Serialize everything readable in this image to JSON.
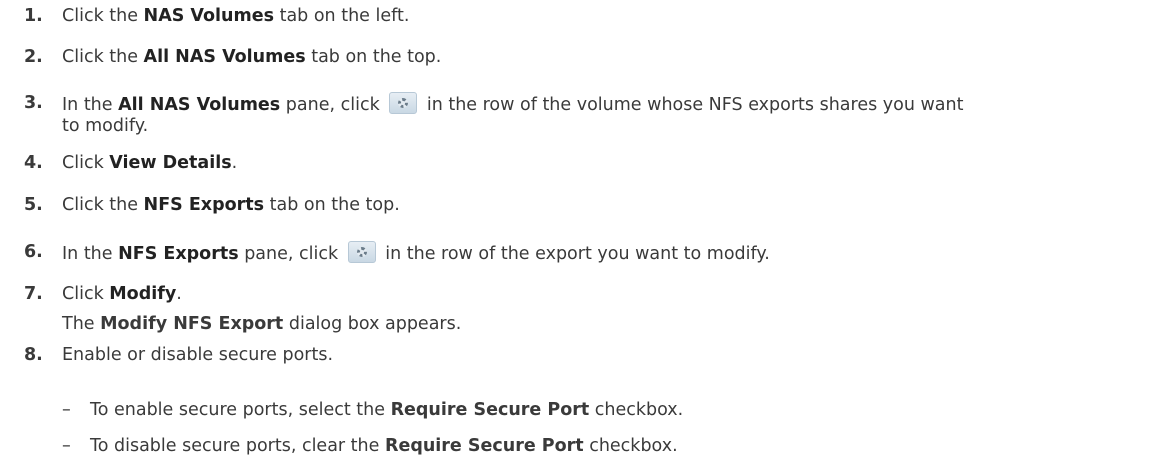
{
  "steps": [
    {
      "num": "1.",
      "pre": "Click the ",
      "b1": "NAS Volumes",
      "post": " tab on the left."
    },
    {
      "num": "2.",
      "pre": "Click the ",
      "b1": "All NAS Volumes",
      "post": " tab on the top."
    },
    {
      "num": "3.",
      "pre": "In the ",
      "b1": "All NAS Volumes",
      "mid": " pane, click ",
      "post": " in the row of the volume whose NFS exports shares you want",
      "line2": "to modify."
    },
    {
      "num": "4.",
      "pre": "Click ",
      "b1": "View Details",
      "post": "."
    },
    {
      "num": "5.",
      "pre": "Click the ",
      "b1": "NFS Exports",
      "post": " tab on the top."
    },
    {
      "num": "6.",
      "pre": "In the ",
      "b1": "NFS Exports",
      "mid": " pane, click ",
      "post": " in the row of the export you want to modify."
    },
    {
      "num": "7.",
      "pre": "Click ",
      "b1": "Modify",
      "post": "."
    },
    {
      "num": "8.",
      "pre": "Enable or disable secure ports."
    }
  ],
  "note7": {
    "pre": "The ",
    "b1": "Modify NFS Export",
    "post": " dialog box appears."
  },
  "bullets": [
    {
      "dash": "–",
      "pre": "To enable secure ports, select the ",
      "b1": "Require Secure Port",
      "post": " checkbox."
    },
    {
      "dash": "–",
      "pre": "To disable secure ports, clear the ",
      "b1": "Require Secure Port",
      "post": " checkbox."
    }
  ],
  "icons": {
    "row_action": "gear-icon"
  }
}
